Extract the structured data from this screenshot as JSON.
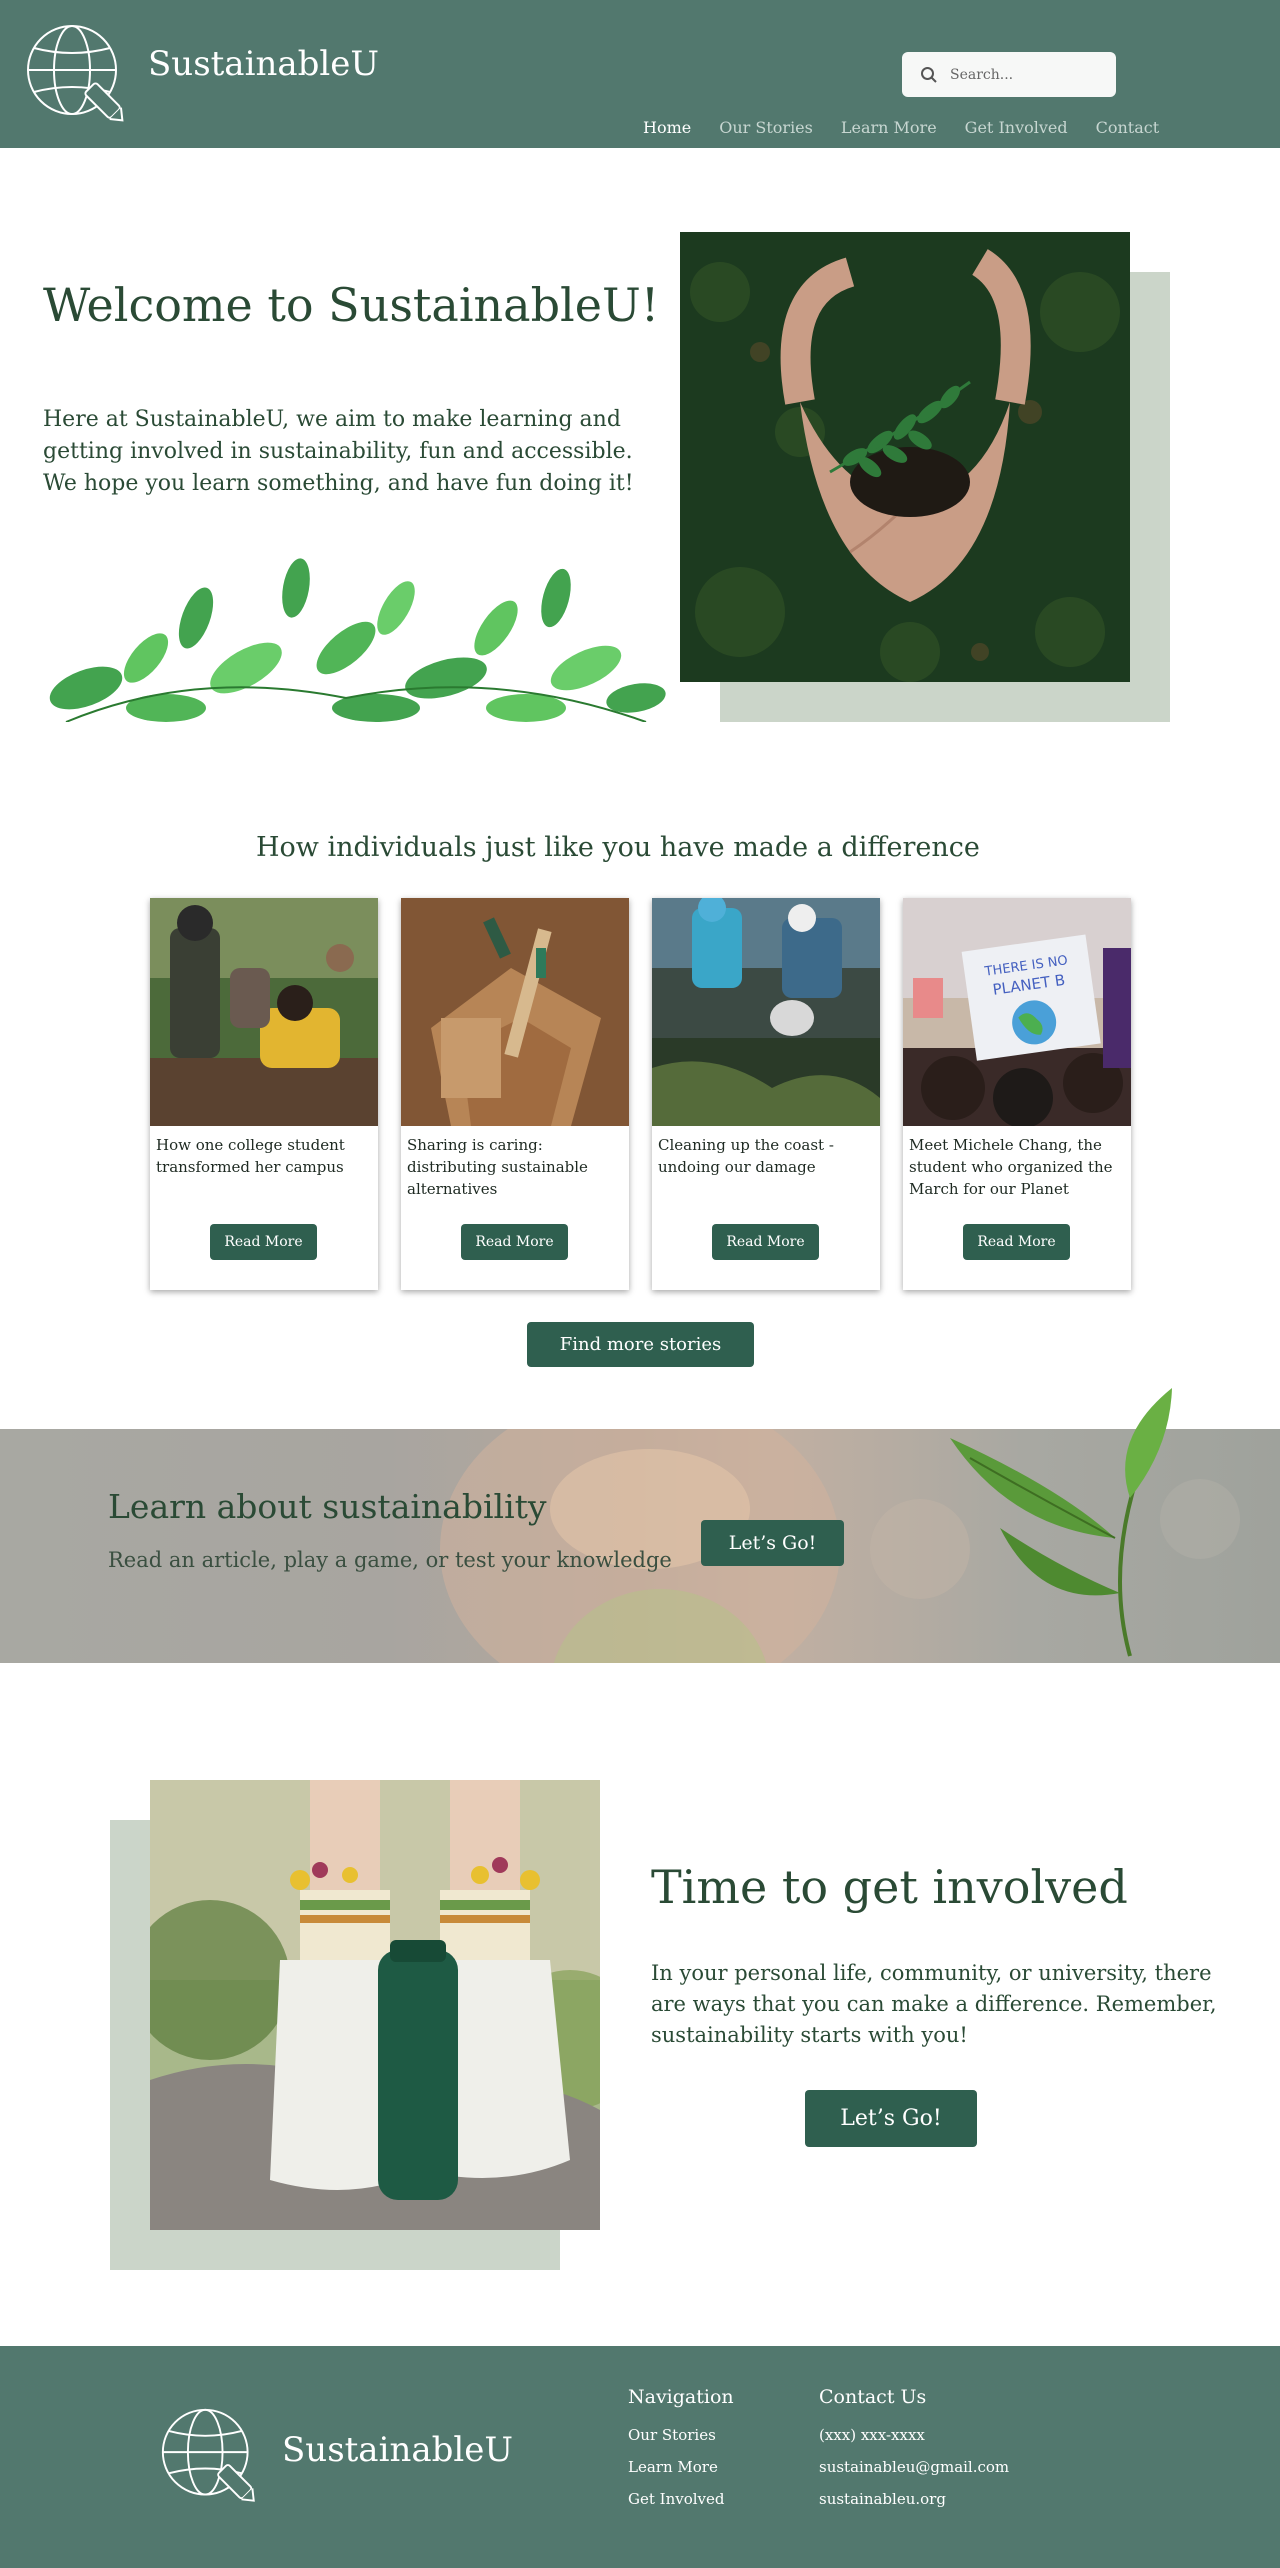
{
  "header": {
    "brand": "SustainableU",
    "search_placeholder": "Search...",
    "nav": [
      {
        "label": "Home",
        "active": true
      },
      {
        "label": "Our Stories"
      },
      {
        "label": "Learn More"
      },
      {
        "label": "Get Involved"
      },
      {
        "label": "Contact"
      }
    ]
  },
  "hero": {
    "title": "Welcome to SustainableU!",
    "text": "Here at SustainableU, we aim to make learning and getting involved in sustainability, fun and accessible. We hope you learn something, and have fun doing it!"
  },
  "stories": {
    "heading": "How individuals just like you have made a difference",
    "cards": [
      {
        "title": "How one college student transformed her campus",
        "button": "Read More"
      },
      {
        "title": "Sharing is caring: distributing sustainable alternatives",
        "button": "Read More"
      },
      {
        "title": "Cleaning up the coast - undoing our damage",
        "button": "Read More"
      },
      {
        "title": "Meet Michele Chang, the student who organized the March for our Planet",
        "button": "Read More"
      }
    ],
    "find_more": "Find more stories",
    "sign_text_1": "THERE IS NO",
    "sign_text_2": "PLANET B"
  },
  "learn": {
    "title": "Learn about sustainability",
    "subtitle": "Read an article, play a game, or test your knowledge",
    "button": "Let’s Go!"
  },
  "involved": {
    "title": "Time to get involved",
    "text": "In your personal life, community, or university, there are ways that you can make a difference. Remember, sustainability starts with you!",
    "button": "Let’s Go!"
  },
  "footer": {
    "brand": "SustainableU",
    "nav_heading": "Navigation",
    "nav_links": [
      "Our Stories",
      "Learn More",
      "Get Involved"
    ],
    "contact_heading": "Contact Us",
    "phone": "(xxx) xxx-xxxx",
    "email": "sustainableu@gmail.com",
    "website": "sustainableu.org"
  },
  "colors": {
    "header_bg": "#52786e",
    "button_bg": "#2f5f4f",
    "text_green": "#2a4a35",
    "backdrop": "#cbd5c9"
  }
}
